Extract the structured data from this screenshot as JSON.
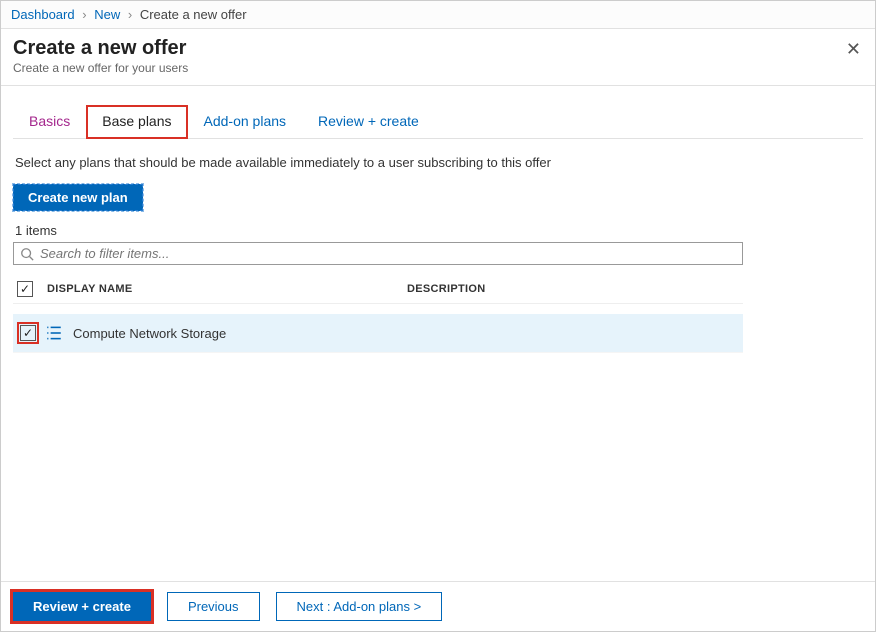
{
  "breadcrumb": {
    "items": [
      "Dashboard",
      "New"
    ],
    "current": "Create a new offer"
  },
  "header": {
    "title": "Create a new offer",
    "subtitle": "Create a new offer for your users"
  },
  "tabs": {
    "basics": "Basics",
    "base_plans": "Base plans",
    "addon_plans": "Add-on plans",
    "review": "Review + create"
  },
  "body": {
    "description": "Select any plans that should be made available immediately to a user subscribing to this offer",
    "create_plan_label": "Create new plan",
    "items_count": "1 items",
    "search_placeholder": "Search to filter items..."
  },
  "table": {
    "col_name": "DISPLAY NAME",
    "col_desc": "DESCRIPTION",
    "rows": [
      {
        "name": "Compute Network Storage",
        "description": ""
      }
    ]
  },
  "footer": {
    "review_label": "Review + create",
    "previous_label": "Previous",
    "next_label": "Next : Add-on plans >"
  }
}
